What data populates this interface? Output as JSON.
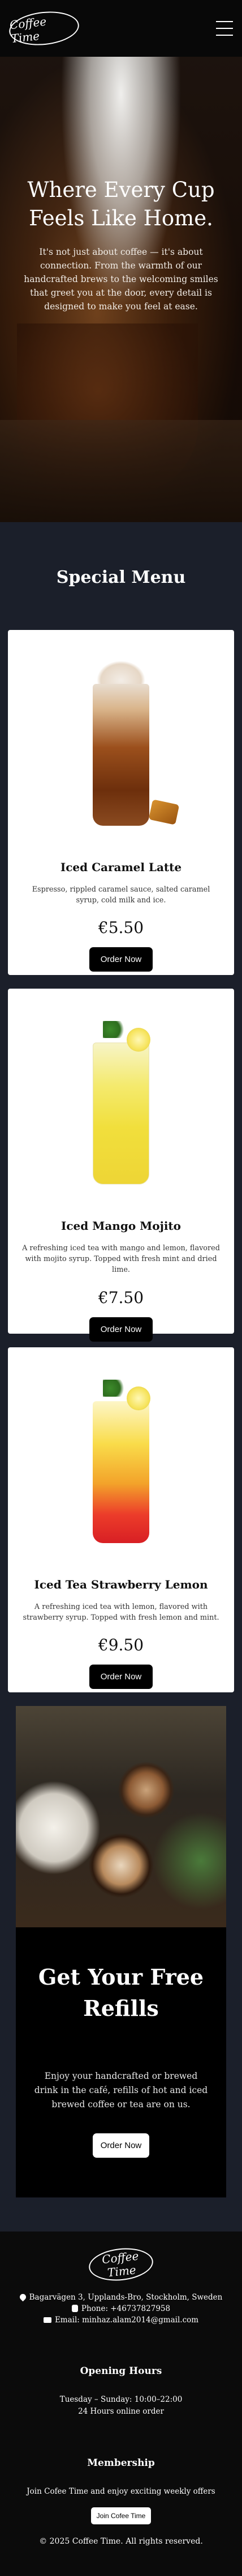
{
  "header": {
    "logo_text": "Coffee Time"
  },
  "hero": {
    "title": "Where Every Cup Feels Like Home.",
    "subtitle": "It's not just about coffee — it's about connection. From the warmth of our handcrafted brews to the welcoming smiles that greet you at the door, every detail is designed to make you feel at ease."
  },
  "menu": {
    "title": "Special Menu",
    "items": [
      {
        "name": "Iced Caramel Latte",
        "description": "Espresso, rippled caramel sauce, salted caramel syrup, cold milk and ice.",
        "price": "€5.50",
        "button": "Order Now"
      },
      {
        "name": "Iced Mango Mojito",
        "description": "A refreshing iced tea with mango and lemon, flavored with mojito syrup. Topped with fresh mint and dried lime.",
        "price": "€7.50",
        "button": "Order Now"
      },
      {
        "name": "Iced Tea Strawberry Lemon",
        "description": "A refreshing iced tea with lemon, flavored with strawberry syrup. Topped with fresh lemon and mint.",
        "price": "€9.50",
        "button": "Order Now"
      }
    ]
  },
  "promo": {
    "title": "Get Your Free Refills",
    "text": "Enjoy your handcrafted or brewed drink in the café, refills of hot and iced brewed coffee or tea are on us.",
    "button": "Order Now"
  },
  "footer": {
    "logo_text": "Coffee Time",
    "address": "Bagarvägen 3, Upplands-Bro, Stockholm, Sweden",
    "phone": "Phone: +46737827958",
    "email": "Email: minhaz.alam2014@gmail.com",
    "hours_title": "Opening Hours",
    "hours_days": "Tuesday – Sunday: 10:00–22:00",
    "hours_note": "24 Hours online order",
    "membership_title": "Membership",
    "membership_text": "Join Cofee Time and enjoy exciting weekly offers",
    "membership_button": "Join Cofee Time",
    "copyright": "© 2025 Coffee Time. All rights reserved."
  }
}
